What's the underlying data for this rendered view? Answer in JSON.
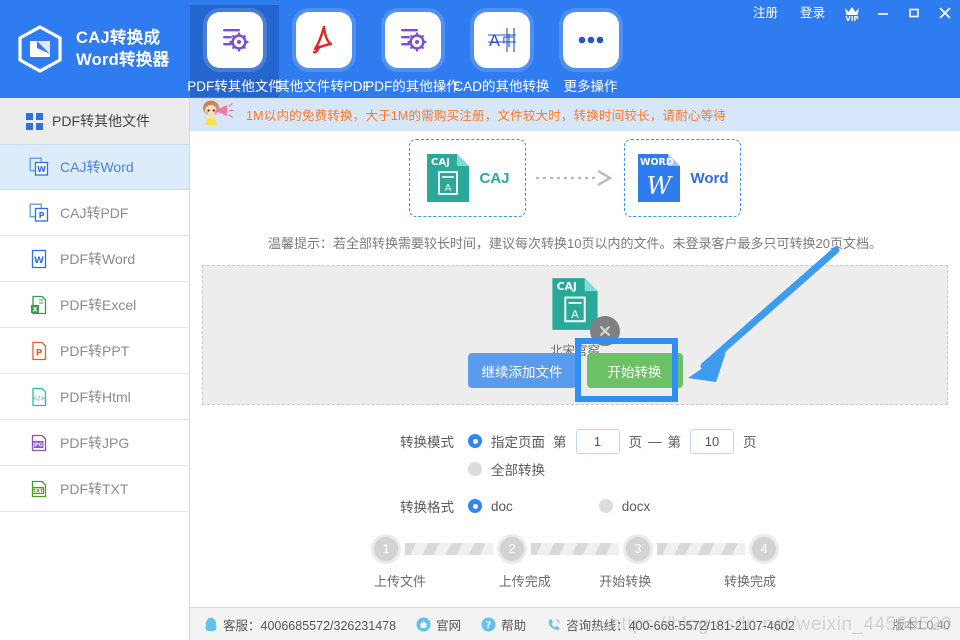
{
  "window": {
    "brand_line1": "CAJ转换成",
    "brand_line2": "Word转换器",
    "register": "注册",
    "login": "登录",
    "vip": "VIP",
    "minimize": "minimize-icon",
    "maximize": "maximize-icon",
    "close": "close-icon",
    "header_bg": "#2f7bf0"
  },
  "toolbar": {
    "items": [
      {
        "label": "PDF转其他文件",
        "icon": "pdf-to-other-icon",
        "active": true
      },
      {
        "label": "其他文件转PDF",
        "icon": "other-to-pdf-icon",
        "active": false
      },
      {
        "label": "PDF的其他操作",
        "icon": "pdf-operations-icon",
        "active": false
      },
      {
        "label": "CAD的其他转换",
        "icon": "cad-convert-icon",
        "active": false
      },
      {
        "label": "更多操作",
        "icon": "more-icon",
        "active": false
      }
    ]
  },
  "sidebar": {
    "header": {
      "label": "PDF转其他文件",
      "icon": "grid-icon"
    },
    "items": [
      {
        "label": "CAJ转Word",
        "icon": "caj-word-icon",
        "selected": true
      },
      {
        "label": "CAJ转PDF",
        "icon": "caj-pdf-icon",
        "selected": false
      },
      {
        "label": "PDF转Word",
        "icon": "word-icon",
        "selected": false
      },
      {
        "label": "PDF转Excel",
        "icon": "excel-icon",
        "selected": false
      },
      {
        "label": "PDF转PPT",
        "icon": "ppt-icon",
        "selected": false
      },
      {
        "label": "PDF转Html",
        "icon": "html-icon",
        "selected": false
      },
      {
        "label": "PDF转JPG",
        "icon": "jpg-icon",
        "selected": false
      },
      {
        "label": "PDF转TXT",
        "icon": "txt-icon",
        "selected": false
      }
    ]
  },
  "notice": {
    "icon": "megaphone-girl-icon",
    "text": "1M以内的免费转换，大于1M的需购买注册，文件较大时，转换时间较长，请耐心等待",
    "color": "#ff7a21",
    "bg": "#d6e6fb"
  },
  "conversion": {
    "source_label": "CAJ",
    "source_badge": "CAJ",
    "source_color": "#2aa89a",
    "target_label": "Word",
    "target_badge": "WORD",
    "target_letter": "W",
    "target_color": "#2f6fe0",
    "arrow": "dotted-arrow-icon"
  },
  "tip": "温馨提示：若全部转换需要较长时间，建议每次转换10页以内的文件。未登录客户最多只可转换20页文档。",
  "drop_area": {
    "file": {
      "name": "北宋官窑",
      "badge": "CAJ",
      "remove_icon": "remove-file-icon"
    },
    "add_button": "继续添加文件",
    "start_button": "开始转换",
    "add_button_color": "#5b9bee",
    "start_button_color": "#6cc066",
    "highlight_color": "#2e90f5"
  },
  "options": {
    "mode_label": "转换模式",
    "mode_specified": "指定页面",
    "page_prefix_1": "第",
    "page_from": "1",
    "page_unit_1": "页",
    "page_dash": "—",
    "page_prefix_2": "第",
    "page_to": "10",
    "page_unit_2": "页",
    "mode_all": "全部转换",
    "format_label": "转换格式",
    "format_doc": "doc",
    "format_docx": "docx",
    "selected_mode": "specified",
    "selected_format": "doc",
    "accent": "#2f86f5"
  },
  "steps": [
    {
      "num": "1",
      "label": "上传文件"
    },
    {
      "num": "2",
      "label": "上传完成"
    },
    {
      "num": "3",
      "label": "开始转换"
    },
    {
      "num": "4",
      "label": "转换完成"
    }
  ],
  "footer": {
    "service": "客服：4006685572/326231478",
    "service_icon": "qq-icon",
    "website": "官网",
    "website_icon": "home-icon",
    "help": "帮助",
    "help_icon": "question-icon",
    "hotline": "咨询热线：400-668-5572/181-2107-4602",
    "hotline_icon": "phone-icon",
    "version": "版本1.0.40"
  },
  "watermark": "https://blog.csdn.net/weixin_44569520"
}
